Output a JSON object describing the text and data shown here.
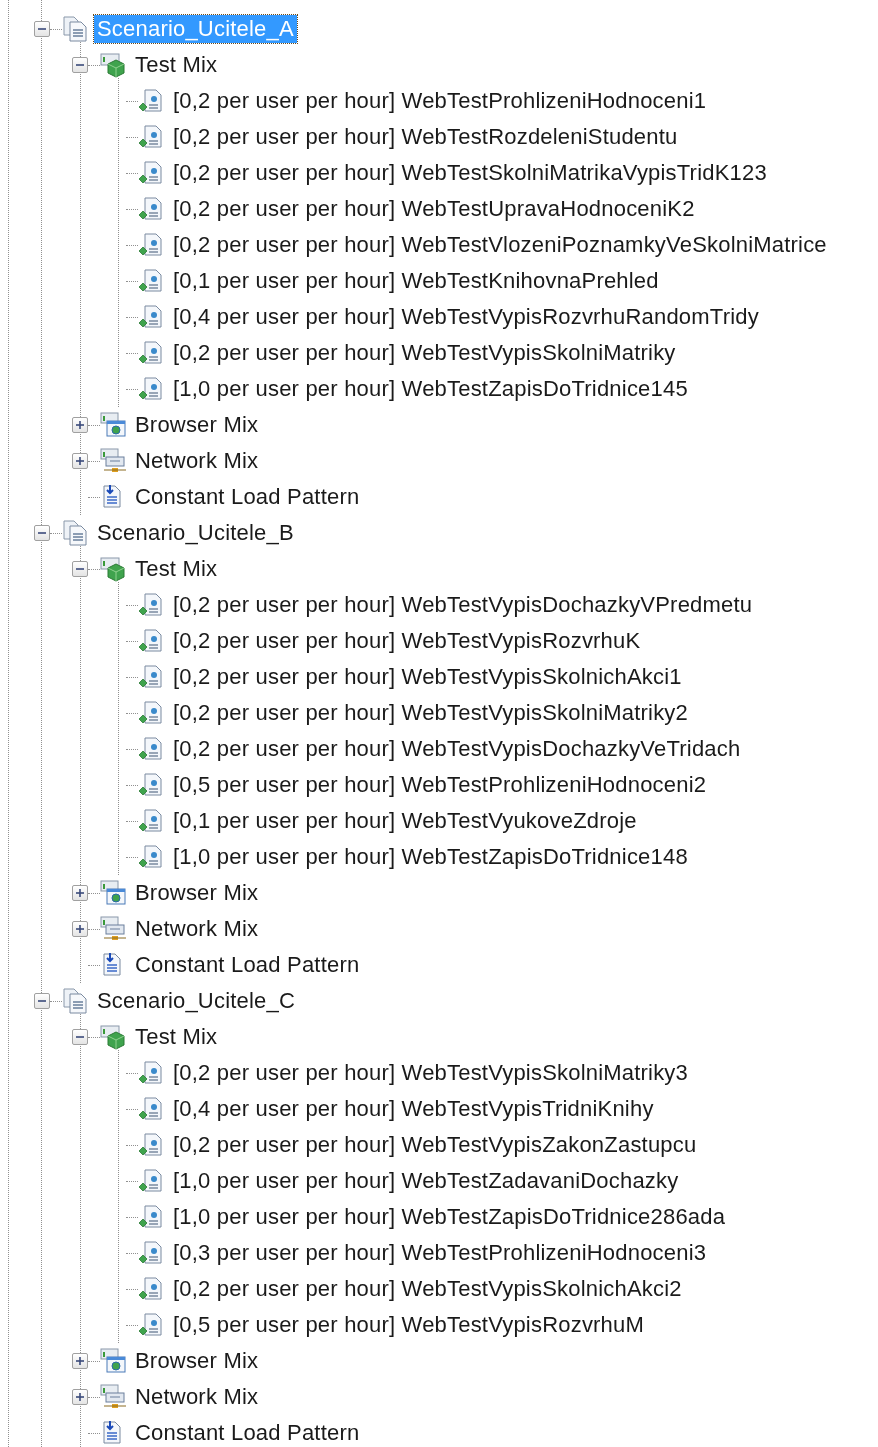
{
  "tree": [
    {
      "kind": "scenario",
      "label": "Scenario_Ucitele_A",
      "expanded": true,
      "selected": true,
      "children": [
        {
          "kind": "test_mix",
          "label": "Test Mix",
          "expanded": true,
          "selected": false,
          "children": [
            {
              "kind": "test",
              "label": "[0,2 per user per hour] WebTestProhlizeniHodnoceni1",
              "selected": false
            },
            {
              "kind": "test",
              "label": "[0,2 per user per hour] WebTestRozdeleniStudentu",
              "selected": false
            },
            {
              "kind": "test",
              "label": "[0,2 per user per hour] WebTestSkolniMatrikaVypisTridK123",
              "selected": false
            },
            {
              "kind": "test",
              "label": "[0,2 per user per hour] WebTestUpravaHodnoceniK2",
              "selected": false
            },
            {
              "kind": "test",
              "label": "[0,2 per user per hour] WebTestVlozeniPoznamkyVeSkolniMatrice",
              "selected": false
            },
            {
              "kind": "test",
              "label": "[0,1 per user per hour] WebTestKnihovnaPrehled",
              "selected": false
            },
            {
              "kind": "test",
              "label": "[0,4 per user per hour] WebTestVypisRozvrhuRandomTridy",
              "selected": false
            },
            {
              "kind": "test",
              "label": "[0,2 per user per hour] WebTestVypisSkolniMatriky",
              "selected": false
            },
            {
              "kind": "test",
              "label": "[1,0 per user per hour] WebTestZapisDoTridnice145",
              "selected": false
            }
          ]
        },
        {
          "kind": "browser_mix",
          "label": "Browser Mix",
          "expanded": false,
          "selected": false
        },
        {
          "kind": "network_mix",
          "label": "Network Mix",
          "expanded": false,
          "selected": false
        },
        {
          "kind": "load_pattern",
          "label": "Constant Load Pattern",
          "selected": false
        }
      ]
    },
    {
      "kind": "scenario",
      "label": "Scenario_Ucitele_B",
      "expanded": true,
      "selected": false,
      "children": [
        {
          "kind": "test_mix",
          "label": "Test Mix",
          "expanded": true,
          "selected": false,
          "children": [
            {
              "kind": "test",
              "label": "[0,2 per user per hour] WebTestVypisDochazkyVPredmetu",
              "selected": false
            },
            {
              "kind": "test",
              "label": "[0,2 per user per hour] WebTestVypisRozvrhuK",
              "selected": false
            },
            {
              "kind": "test",
              "label": "[0,2 per user per hour] WebTestVypisSkolnichAkci1",
              "selected": false
            },
            {
              "kind": "test",
              "label": "[0,2 per user per hour] WebTestVypisSkolniMatriky2",
              "selected": false
            },
            {
              "kind": "test",
              "label": "[0,2 per user per hour] WebTestVypisDochazkyVeTridach",
              "selected": false
            },
            {
              "kind": "test",
              "label": "[0,5 per user per hour] WebTestProhlizeniHodnoceni2",
              "selected": false
            },
            {
              "kind": "test",
              "label": "[0,1 per user per hour] WebTestVyukoveZdroje",
              "selected": false
            },
            {
              "kind": "test",
              "label": "[1,0 per user per hour] WebTestZapisDoTridnice148",
              "selected": false
            }
          ]
        },
        {
          "kind": "browser_mix",
          "label": "Browser Mix",
          "expanded": false,
          "selected": false
        },
        {
          "kind": "network_mix",
          "label": "Network Mix",
          "expanded": false,
          "selected": false
        },
        {
          "kind": "load_pattern",
          "label": "Constant Load Pattern",
          "selected": false
        }
      ]
    },
    {
      "kind": "scenario",
      "label": "Scenario_Ucitele_C",
      "expanded": true,
      "selected": false,
      "children": [
        {
          "kind": "test_mix",
          "label": "Test Mix",
          "expanded": true,
          "selected": false,
          "children": [
            {
              "kind": "test",
              "label": "[0,2 per user per hour] WebTestVypisSkolniMatriky3",
              "selected": false
            },
            {
              "kind": "test",
              "label": "[0,4 per user per hour] WebTestVypisTridniKnihy",
              "selected": false
            },
            {
              "kind": "test",
              "label": "[0,2 per user per hour] WebTestVypisZakonZastupcu",
              "selected": false
            },
            {
              "kind": "test",
              "label": "[1,0 per user per hour] WebTestZadavaniDochazky",
              "selected": false
            },
            {
              "kind": "test",
              "label": "[1,0 per user per hour] WebTestZapisDoTridnice286ada",
              "selected": false
            },
            {
              "kind": "test",
              "label": "[0,3 per user per hour] WebTestProhlizeniHodnoceni3",
              "selected": false
            },
            {
              "kind": "test",
              "label": "[0,2 per user per hour] WebTestVypisSkolnichAkci2",
              "selected": false
            },
            {
              "kind": "test",
              "label": "[0,5 per user per hour] WebTestVypisRozvrhuM",
              "selected": false
            }
          ]
        },
        {
          "kind": "browser_mix",
          "label": "Browser Mix",
          "expanded": false,
          "selected": false
        },
        {
          "kind": "network_mix",
          "label": "Network Mix",
          "expanded": false,
          "selected": false
        },
        {
          "kind": "load_pattern",
          "label": "Constant Load Pattern",
          "selected": false
        }
      ]
    }
  ]
}
